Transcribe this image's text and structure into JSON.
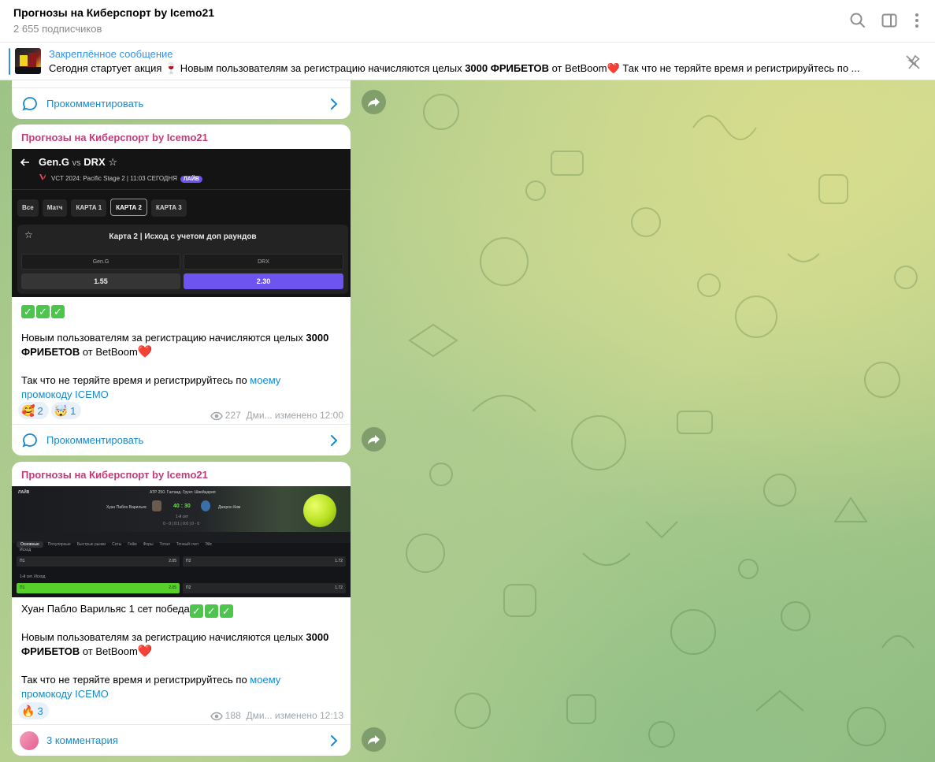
{
  "header": {
    "channel_title": "Прогнозы на Киберспорт by Icemo21",
    "subscribers": "2 655 подписчиков",
    "icons": [
      "search-icon",
      "sidebar-icon",
      "more-vertical-icon"
    ]
  },
  "pinned": {
    "label": "Закреплённое сообщение",
    "text_pre": "Сегодня стартует акция 🍷 Новым пользователям за регистрацию начисляются целых ",
    "text_bold": "3000 ФРИБЕТОВ",
    "text_post": " от BetBoom❤️  Так что не теряйте время и регистрируйтесь по ..."
  },
  "messages": [
    {
      "comments_label": "Прокомментировать"
    },
    {
      "author": "Прогнозы на Киберспорт by Icemo21",
      "screenshot": {
        "team1": "Gen.G",
        "vs": "vs",
        "team2": "DRX",
        "event": "VCT 2024: Pacific Stage 2 | 11:03 СЕГОДНЯ",
        "live": "ЛАЙВ",
        "tabs": [
          "Все",
          "Матч",
          "КАРТА 1",
          "КАРТА 2",
          "КАРТА 3"
        ],
        "market_title": "Карта 2 | Исход с учетом доп раундов",
        "team1_label": "Gen.G",
        "team2_label": "DRX",
        "odd1": "1.55",
        "odd2": "2.30"
      },
      "text_1_pre": "Новым пользователям за регистрацию начисляются целых ",
      "text_1_bold": "3000",
      "text_2_bold": "ФРИБЕТОВ",
      "text_2_post": " от BetBoom",
      "text_3": "Так что не теряйте время и регистрируйтесь по ",
      "link_1": "моему",
      "link_2": "промокоду ICEMO",
      "reactions": [
        {
          "emoji": "🥰",
          "count": "2"
        },
        {
          "emoji": "🤯",
          "count": "1"
        }
      ],
      "views": "227",
      "meta": "Дми...  изменено 12:00",
      "comments_label": "Прокомментировать"
    },
    {
      "author": "Прогнозы на Киберспорт by Icemo21",
      "screenshot": {
        "live": "ЛАЙВ",
        "tournament": "ATP 250. Гштаад. Грунт. Швейцария",
        "player1": "Хуан Пабло Варильяс",
        "score": "40 : 30",
        "player2": "Джерон Ким",
        "set": "1-й сет",
        "games": "0 - 0  |  0:1  |  0:0  |  0 - 0",
        "tabs": [
          "Основные",
          "Популярные",
          "Быстрые рынки",
          "Сеты",
          "Гейм",
          "Форы",
          "Тотал",
          "Точный счет",
          "Эйс"
        ],
        "market1": "Исход",
        "m1_left": "П1",
        "m1_left_odd": "2.05",
        "m1_right": "П2",
        "m1_right_odd": "1.72",
        "market2": "1-й сет. Исход",
        "m2_left": "П1",
        "m2_left_odd": "2.05",
        "m2_right": "П2",
        "m2_right_odd": "1.72"
      },
      "text_0": "Хуан Пабло Варильяс 1 сет победа",
      "text_1_pre": "Новым пользователям за регистрацию начисляются целых ",
      "text_1_bold": "3000",
      "text_2_bold": "ФРИБЕТОВ",
      "text_2_post": " от BetBoom",
      "text_3": "Так что не теряйте время и регистрируйтесь по ",
      "link_1": "моему",
      "link_2": "промокоду ICEMO",
      "reactions": [
        {
          "emoji": "🔥",
          "count": "3"
        }
      ],
      "views": "188",
      "meta": "Дми...  изменено 12:13",
      "comments_label": "3 комментария"
    }
  ],
  "colors": {
    "accent": "#3390ec",
    "link": "#168acd",
    "author": "#c23c7a",
    "check": "#4cc54c",
    "purple": "#6d54f0",
    "tennis_green": "#57d12a"
  }
}
